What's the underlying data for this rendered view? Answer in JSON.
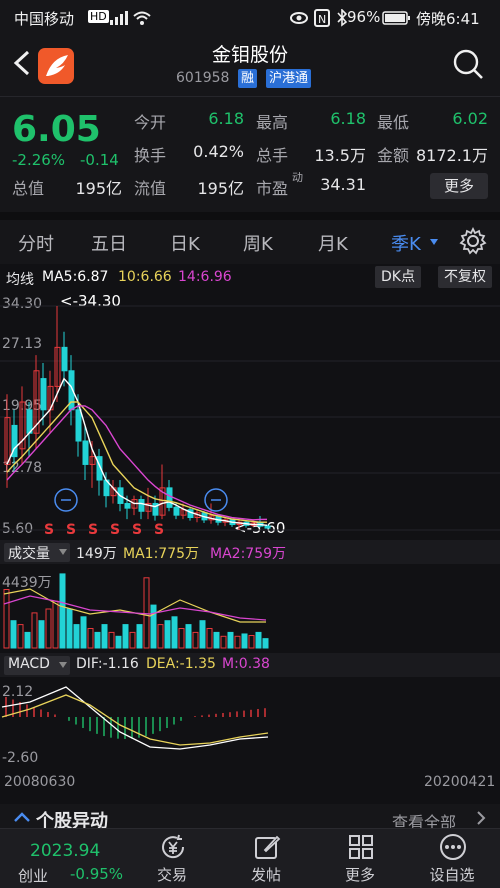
{
  "status_bar": {
    "carrier": "中国移动",
    "battery": "96%",
    "time": "傍晚6:41"
  },
  "header": {
    "title": "金钼股份",
    "code": "601958",
    "tag_margin": "融",
    "tag_connect": "沪港通"
  },
  "quote": {
    "price": "6.05",
    "change_pct": "-2.26%",
    "change_abs": "-0.14",
    "rows": [
      [
        {
          "label": "今开",
          "value": "6.18",
          "green": true
        },
        {
          "label": "最高",
          "value": "6.18",
          "green": true
        },
        {
          "label": "最低",
          "value": "6.02",
          "green": true
        }
      ],
      [
        {
          "label": "换手",
          "value": "0.42%"
        },
        {
          "label": "总手",
          "value": "13.5万"
        },
        {
          "label": "金额",
          "value": "8172.1万"
        }
      ],
      [
        {
          "label": "总值",
          "value": "195亿"
        },
        {
          "label": "流值",
          "value": "195亿"
        },
        {
          "label": "市盈",
          "value": "34.31",
          "sup": "动"
        }
      ]
    ],
    "more_label": "更多"
  },
  "tabs": {
    "items": [
      "分时",
      "五日",
      "日K",
      "周K",
      "月K",
      "季K"
    ],
    "active_index": 5
  },
  "kline": {
    "legend_title": "均线",
    "ma5": "MA5:6.87",
    "ma10": "10:6.66",
    "ma14": "14:6.96",
    "btn_dk": "DK点",
    "btn_adjust": "不复权",
    "y_ticks": [
      "34.30",
      "27.13",
      "19.95",
      "12.78",
      "5.60"
    ],
    "high_mark": "<-34.30",
    "low_mark": "<-5.60",
    "sell_mark": "S"
  },
  "volume": {
    "selector": "成交量",
    "value": "149万",
    "ma1": "MA1:775万",
    "ma2": "MA2:759万",
    "y_max": "4439万"
  },
  "macd": {
    "selector": "MACD",
    "dif": "DIF:-1.16",
    "dea": "DEA:-1.35",
    "m": "M:0.38",
    "y_top": "2.12",
    "y_bottom": "-2.60",
    "date_start": "20080630",
    "date_end": "20200421"
  },
  "movement": {
    "title": "个股异动",
    "view_all": "查看全部"
  },
  "bottom_nav": {
    "index_value": "2023.94",
    "index_name": "创业",
    "index_change": "-0.95%",
    "items": [
      "交易",
      "发帖",
      "更多",
      "设自选"
    ]
  },
  "colors": {
    "up": "#e8393c",
    "down": "#22d3d6",
    "green": "#1fc16b",
    "accent": "#4a8cf0",
    "ma5": "#ffffff",
    "ma10": "#e8d35a",
    "ma14": "#d946d0"
  }
}
